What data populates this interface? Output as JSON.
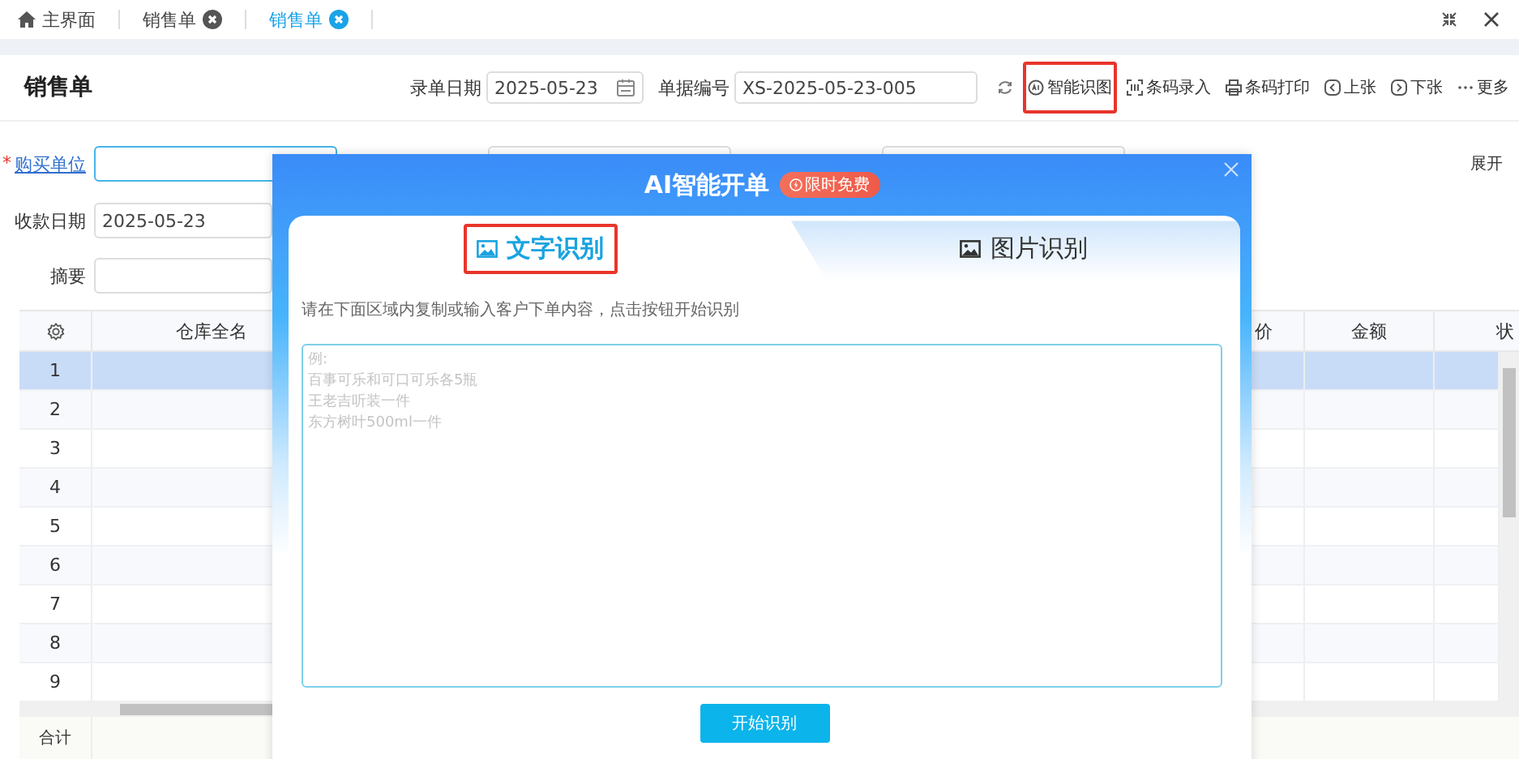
{
  "tabs": [
    {
      "label": "主界面",
      "kind": "home",
      "selected": false
    },
    {
      "label": "销售单",
      "kind": "document",
      "selected": false
    },
    {
      "label": "销售单",
      "kind": "document",
      "selected": true
    }
  ],
  "header": {
    "title": "销售单",
    "date_label": "录单日期",
    "date": "2025-05-23",
    "number_label": "单据编号",
    "number": "XS-2025-05-23-005"
  },
  "toolbar": [
    {
      "label": "智能识图",
      "kind": "ai",
      "highlighted": true
    },
    {
      "label": "条码录入",
      "kind": "scan",
      "highlighted": false
    },
    {
      "label": "条码打印",
      "kind": "print",
      "highlighted": false
    },
    {
      "label": "上张",
      "kind": "prev",
      "highlighted": false
    },
    {
      "label": "下张",
      "kind": "next",
      "highlighted": false
    },
    {
      "label": "更多",
      "kind": "more",
      "highlighted": false
    }
  ],
  "form": {
    "required_mark": "*",
    "buyer_label": "购买单位",
    "expand": "展开",
    "pay_date_label": "收款日期",
    "pay_date": "2025-05-23",
    "memo_label": "摘要"
  },
  "table": {
    "columns": [
      "仓库全名",
      "价",
      "金额",
      "状"
    ],
    "rows": [
      {
        "number": "1",
        "selected": true
      },
      {
        "number": "2",
        "selected": false
      },
      {
        "number": "3",
        "selected": false
      },
      {
        "number": "4",
        "selected": false
      },
      {
        "number": "5",
        "selected": false
      },
      {
        "number": "6",
        "selected": false
      },
      {
        "number": "7",
        "selected": false
      },
      {
        "number": "8",
        "selected": false
      },
      {
        "number": "9",
        "selected": false
      }
    ],
    "footer": "合计"
  },
  "dialog": {
    "title": "AI智能开单",
    "badge": "限时免费",
    "tabs": [
      {
        "label": "文字识别",
        "selected": true,
        "highlighted": true
      },
      {
        "label": "图片识别",
        "selected": false,
        "highlighted": false
      }
    ],
    "hint": "请在下面区域内复制或输入客户下单内容，点击按钮开始识别",
    "placeholder_lines": [
      "例:",
      "百事可乐和可口可乐各5瓶",
      "王老吉听装一件",
      "东方树叶500ml一件"
    ],
    "button": "开始识别"
  }
}
